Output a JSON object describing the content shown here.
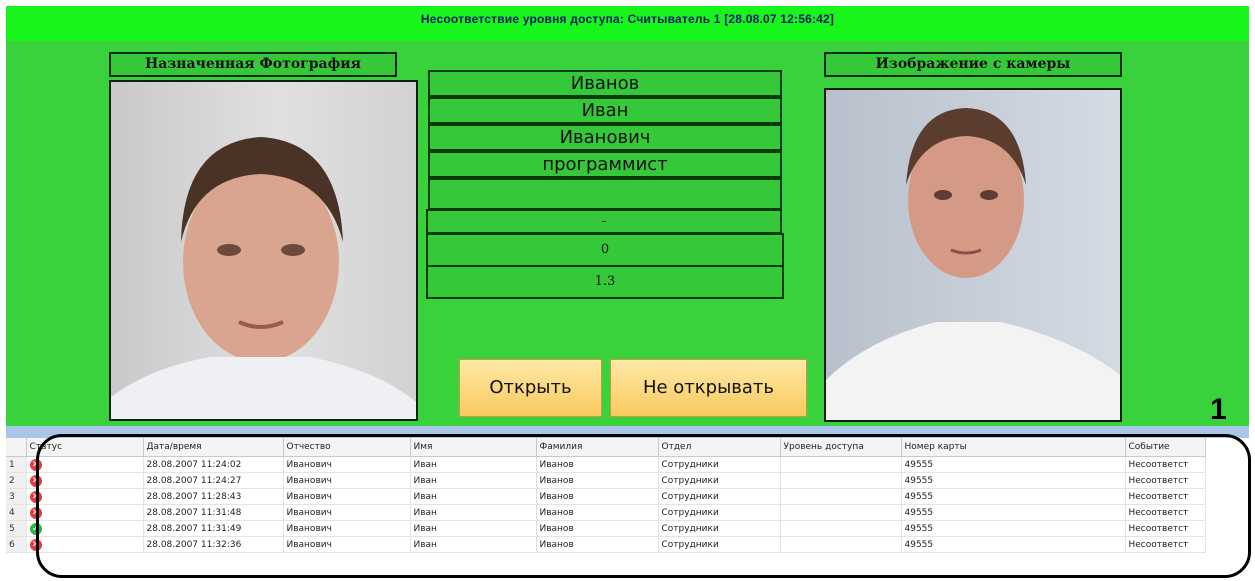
{
  "header": {
    "title": "Несоответствие уровня доступа: Считыватель 1 [28.08.07 12:56:42]"
  },
  "left_photo": {
    "caption": "Назначенная Фотография"
  },
  "right_photo": {
    "caption": "Изображение с камеры"
  },
  "person": {
    "last_name": "Иванов",
    "first_name": "Иван",
    "patronymic": "Иванович",
    "position": "программист",
    "field5": "",
    "field6": "-",
    "field7": "0",
    "field8": "1.3"
  },
  "buttons": {
    "open": "Открыть",
    "no_open": "Не открывать"
  },
  "marker": "1",
  "table": {
    "columns": [
      "",
      "Статус",
      "Дата/время",
      "Отчество",
      "Имя",
      "Фамилия",
      "Отдел",
      "Уровень доступа",
      "Номер карты",
      "Событие"
    ],
    "rows": [
      {
        "n": "1",
        "status": "error",
        "datetime": "28.08.2007 11:24:02",
        "patronymic": "Иванович",
        "name": "Иван",
        "surname": "Иванов",
        "dept": "Сотрудники",
        "level": "",
        "card": "49555",
        "event": "Несоответст"
      },
      {
        "n": "2",
        "status": "error",
        "datetime": "28.08.2007 11:24:27",
        "patronymic": "Иванович",
        "name": "Иван",
        "surname": "Иванов",
        "dept": "Сотрудники",
        "level": "",
        "card": "49555",
        "event": "Несоответст"
      },
      {
        "n": "3",
        "status": "error",
        "datetime": "28.08.2007 11:28:43",
        "patronymic": "Иванович",
        "name": "Иван",
        "surname": "Иванов",
        "dept": "Сотрудники",
        "level": "",
        "card": "49555",
        "event": "Несоответст"
      },
      {
        "n": "4",
        "status": "error",
        "datetime": "28.08.2007 11:31:48",
        "patronymic": "Иванович",
        "name": "Иван",
        "surname": "Иванов",
        "dept": "Сотрудники",
        "level": "",
        "card": "49555",
        "event": "Несоответст"
      },
      {
        "n": "5",
        "status": "ok",
        "datetime": "28.08.2007 11:31:49",
        "patronymic": "Иванович",
        "name": "Иван",
        "surname": "Иванов",
        "dept": "Сотрудники",
        "level": "",
        "card": "49555",
        "event": "Несоответст"
      },
      {
        "n": "6",
        "status": "error",
        "datetime": "28.08.2007 11:32:36",
        "patronymic": "Иванович",
        "name": "Иван",
        "surname": "Иванов",
        "dept": "Сотрудники",
        "level": "",
        "card": "49555",
        "event": "Несоответст"
      }
    ]
  },
  "icons": {
    "error": "error-x-icon",
    "ok": "ok-check-icon"
  },
  "colors": {
    "panel": "#39d23d",
    "header": "#17f51a",
    "button": "#f8c95f"
  }
}
